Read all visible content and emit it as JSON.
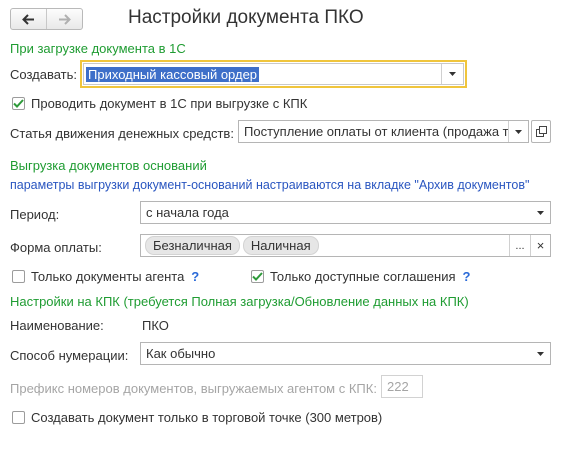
{
  "window": {
    "title": "Настройки документа ПКО"
  },
  "section_load": {
    "header": "При загрузке документа в 1С",
    "create_label": "Создавать:",
    "create_value": "Приходный кассовый ордер",
    "post_doc_label": "Проводить документ в 1С при выгрузке с КПК",
    "post_doc_checked": true,
    "cashflow_label": "Статья движения денежных средств:",
    "cashflow_value": "Поступление оплаты от клиента (продажа то"
  },
  "section_export": {
    "header": "Выгрузка документов оснований",
    "note": "параметры выгрузки документ-оснований настраиваются на вкладке \"Архив документов\"",
    "period_label": "Период:",
    "period_value": "с начала года",
    "payment_label": "Форма оплаты:",
    "payment_tags": [
      "Безналичная",
      "Наличная"
    ],
    "more_button": "...",
    "clear_button": "×",
    "agent_docs_label": "Только документы агента",
    "agent_docs_checked": false,
    "available_agreements_label": "Только доступные соглашения",
    "available_agreements_checked": true,
    "help": "?"
  },
  "section_kpk": {
    "header": "Настройки на КПК (требуется Полная загрузка/Обновление данных на КПК)",
    "name_label": "Наименование:",
    "name_value": "ПКО",
    "numbering_label": "Способ нумерации:",
    "numbering_value": "Как обычно",
    "prefix_label": "Префикс номеров документов, выгружаемых агентом с КПК:",
    "prefix_value": "222",
    "shop_only_label": "Создавать документ только в торговой точке (300 метров)",
    "shop_only_checked": false
  },
  "colors": {
    "section_green": "#1f9c32",
    "link_blue": "#2a56c0",
    "focus_yellow": "#f0c53c",
    "select_blue": "#3e6fc9"
  },
  "icons": [
    "back-arrow-icon",
    "forward-arrow-icon",
    "chevron-down-icon",
    "open-window-icon",
    "check-icon"
  ]
}
